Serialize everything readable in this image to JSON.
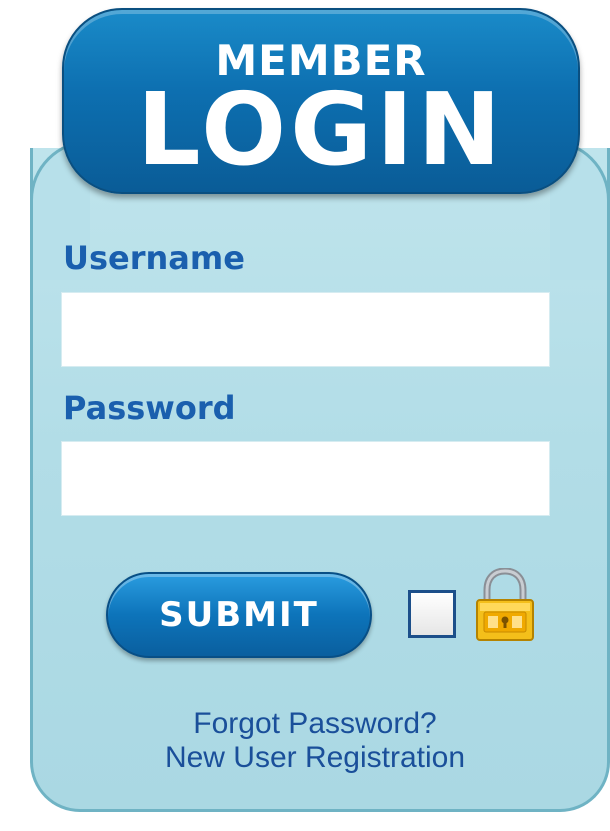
{
  "header": {
    "top_text": "MEMBER",
    "main_text": "LOGIN"
  },
  "form": {
    "username_label": "Username",
    "username_value": "",
    "password_label": "Password",
    "password_value": "",
    "submit_label": "SUBMIT",
    "remember_checked": false
  },
  "links": {
    "forgot_password": "Forgot Password?",
    "new_user_registration": "New User Registration"
  },
  "icons": {
    "checkbox": "checkbox-icon",
    "lock": "padlock-icon"
  },
  "colors": {
    "header_blue": "#0d6fb0",
    "panel_blue": "#b2dde7",
    "label_blue": "#1a5fae",
    "lock_gold": "#f2b705"
  }
}
